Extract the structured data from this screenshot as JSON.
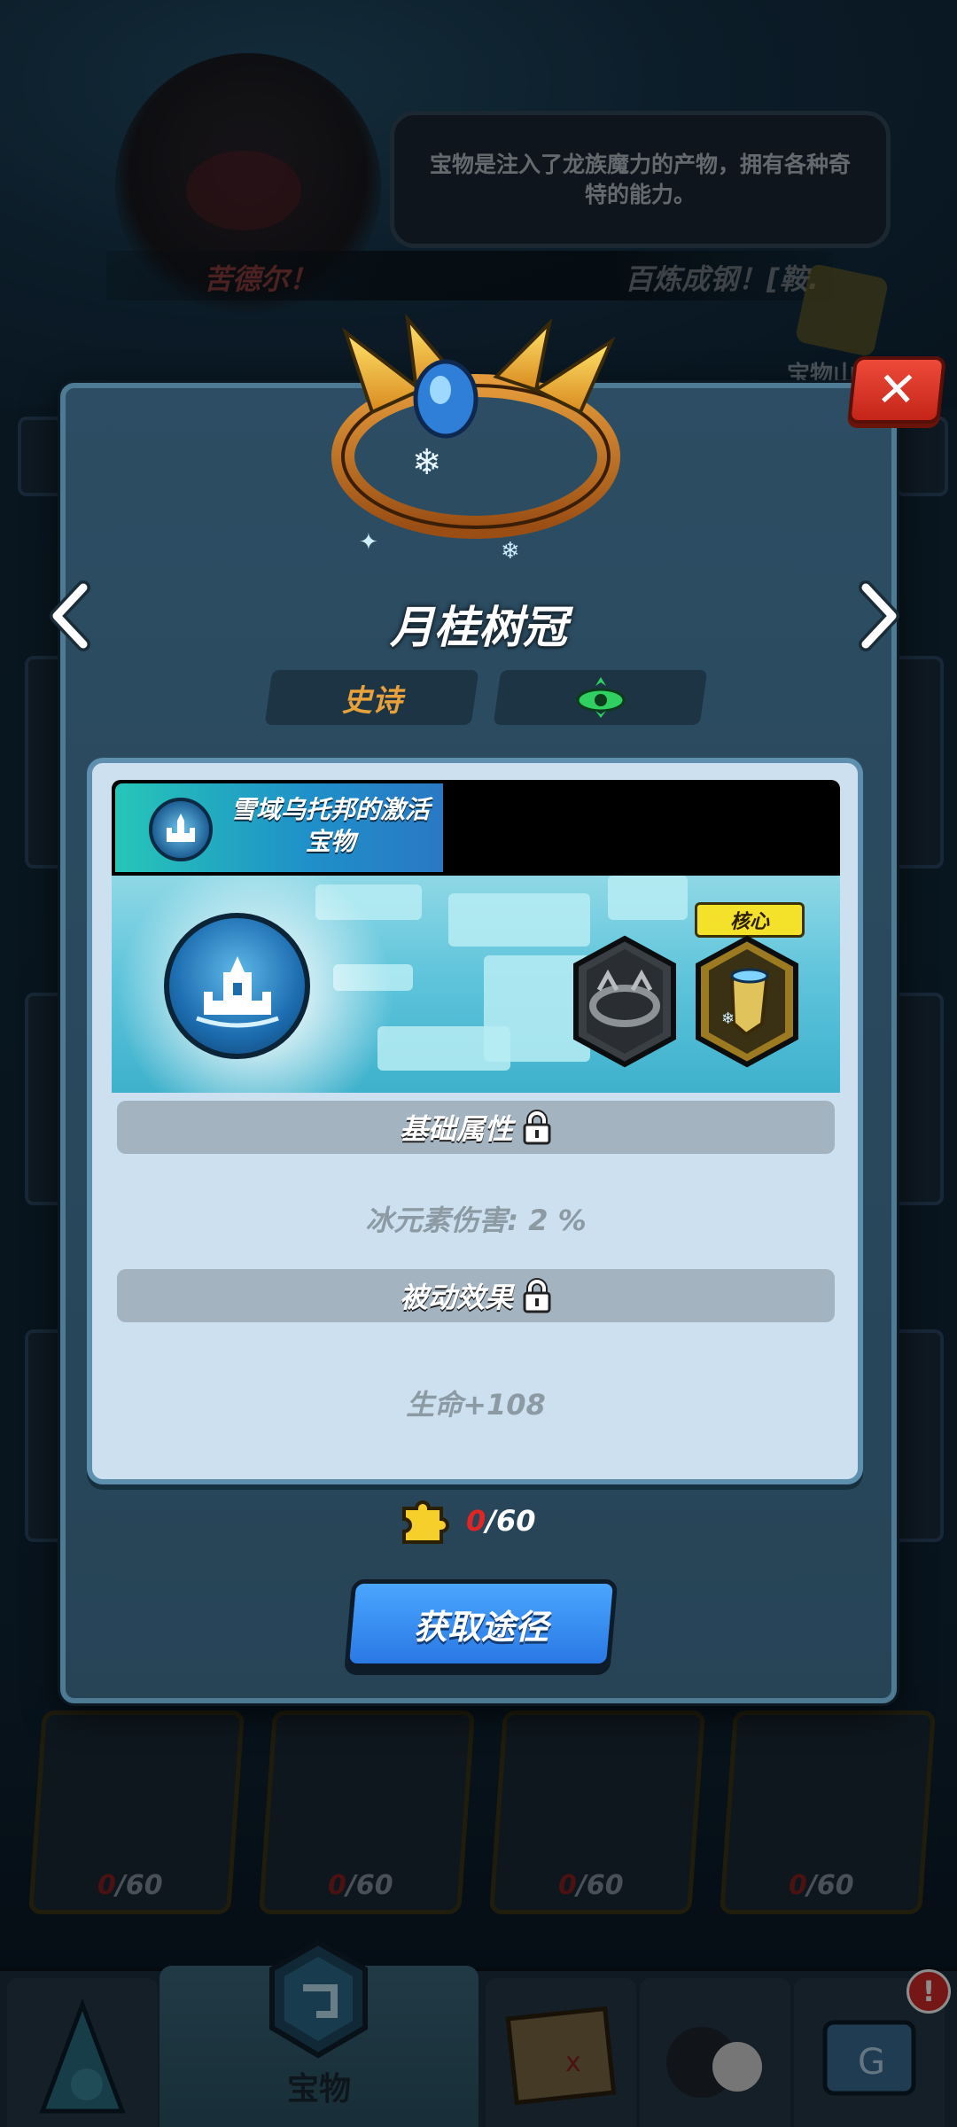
{
  "speech": {
    "text": "宝物是注入了龙族魔力的产物，拥有各种奇特的能力。"
  },
  "banner": {
    "left_name": "苦德尔！",
    "right_text": "百炼成钢！[鞍."
  },
  "shop": {
    "label": "宝物山"
  },
  "modal": {
    "close_symbol": "✕",
    "prev_symbol": "‹",
    "next_symbol": "›",
    "item_name": "月桂树冠",
    "rarity": "史诗",
    "element_icon": "eye-icon",
    "set": {
      "name": "雪域乌托邦的激活宝物",
      "core_label": "核心"
    },
    "base_section": {
      "title": "基础属性",
      "stat": "冰元素伤害: 2 %"
    },
    "passive_section": {
      "title": "被动效果",
      "stat": "生命+108"
    },
    "progress": {
      "current": "0",
      "total": "/60"
    },
    "source_button": "获取途径"
  },
  "background_tiles": [
    {
      "current": "0",
      "total": "/60"
    },
    {
      "current": "0",
      "total": "/60"
    },
    {
      "current": "0",
      "total": "/60"
    },
    {
      "current": "0",
      "total": "/60"
    }
  ],
  "bottom_nav": {
    "active_label": "宝物",
    "badge": "!"
  },
  "colors": {
    "accent_blue": "#2a78e4",
    "rarity_gold": "#e7a23c",
    "close_red": "#e2362a",
    "core_yellow": "#f4e12a",
    "progress_red": "#e12525"
  }
}
